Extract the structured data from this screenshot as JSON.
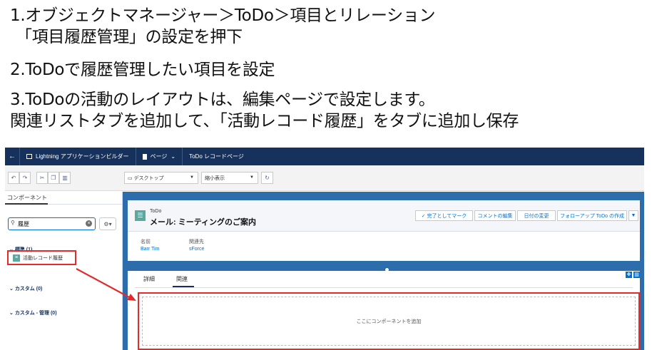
{
  "instructions": {
    "line1": "1.オブジェクトマネージャー＞ToDo＞項目とリレーション",
    "line2": "「項目履歴管理」の設定を押下",
    "line3": "2.ToDoで履歴管理したい項目を設定",
    "line4": "3.ToDoの活動のレイアウトは、編集ページで設定します。",
    "line5": "関連リストタブを追加して、「活動レコード履歴」をタブに追加し保存"
  },
  "topbar": {
    "app_builder": "Lightning アプリケーションビルダー",
    "page_menu": "ページ",
    "page_name": "ToDo レコードページ"
  },
  "toolbar": {
    "device": "デスクトップ",
    "zoom": "縮小表示"
  },
  "left_panel": {
    "tab": "コンポーネント",
    "search_value": "履歴",
    "sections": {
      "standard": "標準 (1)",
      "custom": "カスタム (0)",
      "custom_managed": "カスタム - 管理 (0)"
    },
    "component_item": "活動レコード履歴"
  },
  "record": {
    "object_label": "ToDo",
    "title": "メール: ミーティングのご案内",
    "actions": [
      "完了としてマーク",
      "コメントの編集",
      "日付の変更",
      "フォローアップ ToDo の作成"
    ],
    "fields": [
      {
        "label": "名前",
        "value": "Barr Tim"
      },
      {
        "label": "関連先",
        "value": "sForce"
      }
    ]
  },
  "tabs": {
    "details": "詳細",
    "related": "関連",
    "dropzone": "ここにコンポーネントを追加"
  },
  "colors": {
    "navy": "#16325c",
    "canvas_blue": "#2d6dab",
    "highlight_red": "#e32b2b",
    "link_blue": "#0070d2"
  }
}
